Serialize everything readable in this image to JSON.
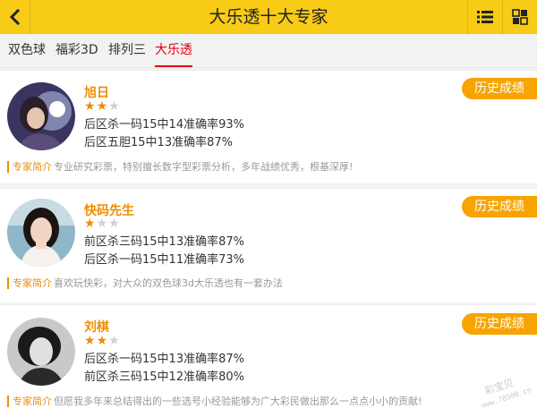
{
  "header": {
    "title": "大乐透十大专家"
  },
  "tabs": [
    {
      "label": "双色球"
    },
    {
      "label": "福彩3D"
    },
    {
      "label": "排列三"
    },
    {
      "label": "大乐透"
    }
  ],
  "experts": [
    {
      "name": "旭日",
      "rating": 2,
      "rating_max": 3,
      "stats": [
        "后区杀一码15中14准确率93%",
        "后区五胆15中13准确率87%"
      ],
      "history_label": "历史成绩",
      "intro_label": "专家简介",
      "intro_text": "专业研究彩票，特别擅长数字型彩票分析，多年战绩优秀，根基深厚!"
    },
    {
      "name": "快码先生",
      "rating": 1,
      "rating_max": 3,
      "stats": [
        "前区杀三码15中13准确率87%",
        "后区杀一码15中11准确率73%"
      ],
      "history_label": "历史成绩",
      "intro_label": "专家简介",
      "intro_text": "喜欢玩快彩，对大众的双色球3d大乐透也有一套办法"
    },
    {
      "name": "刘棋",
      "rating": 2,
      "rating_max": 3,
      "stats": [
        "后区杀一码15中13准确率87%",
        "前区杀三码15中12准确率80%"
      ],
      "history_label": "历史成绩",
      "intro_label": "专家简介",
      "intro_text": "但愿我多年来总结得出的一些选号小经验能够为广大彩民做出那么一点点小小的贡献!"
    }
  ],
  "watermark": {
    "line1": "彩宝贝",
    "line2": "www.78500.cn"
  },
  "colors": {
    "header_bg": "#f7cb16",
    "accent": "#f08c00",
    "history_bg": "#f7a400",
    "active_tab": "#e60012"
  },
  "icons": {
    "back": "chevron-left-icon",
    "menu": "list-icon",
    "grid": "grid-icon"
  }
}
